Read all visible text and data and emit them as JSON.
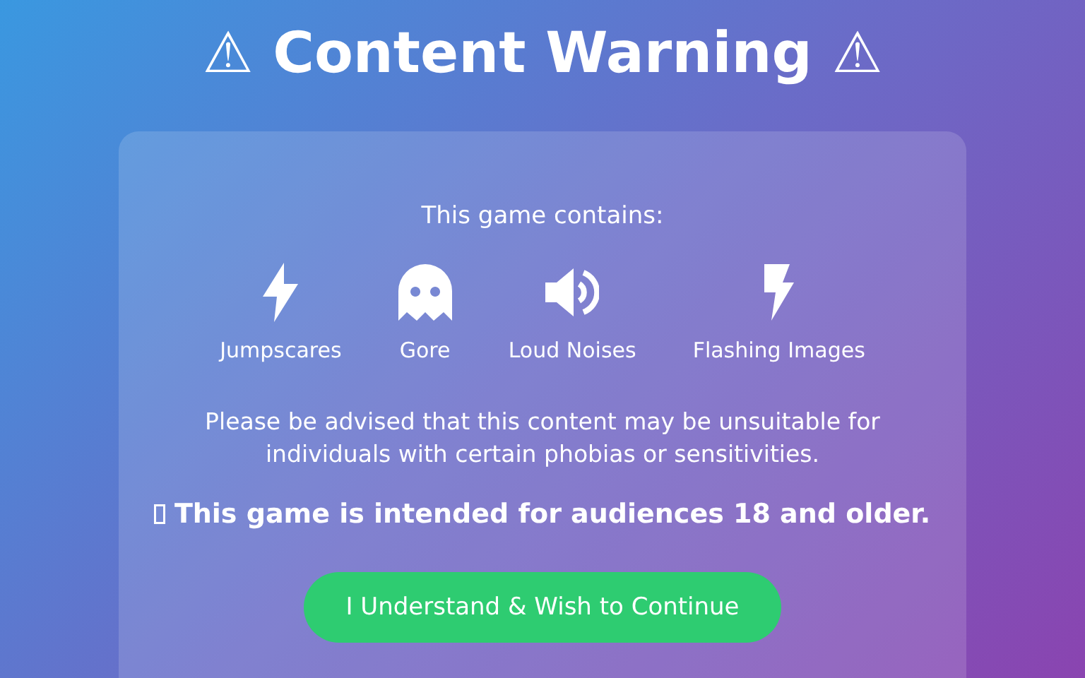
{
  "title": "⚠ Content Warning ⚠",
  "card": {
    "intro": "This game contains:",
    "items": [
      {
        "label": "Jumpscares"
      },
      {
        "label": "Gore"
      },
      {
        "label": "Loud Noises"
      },
      {
        "label": "Flashing Images"
      }
    ],
    "advisory": "Please be advised that this content may be unsuitable for individuals with certain phobias or sensitivities.",
    "age_notice": "This game is intended for audiences 18 and older.",
    "button": "I Understand & Wish to Continue"
  }
}
